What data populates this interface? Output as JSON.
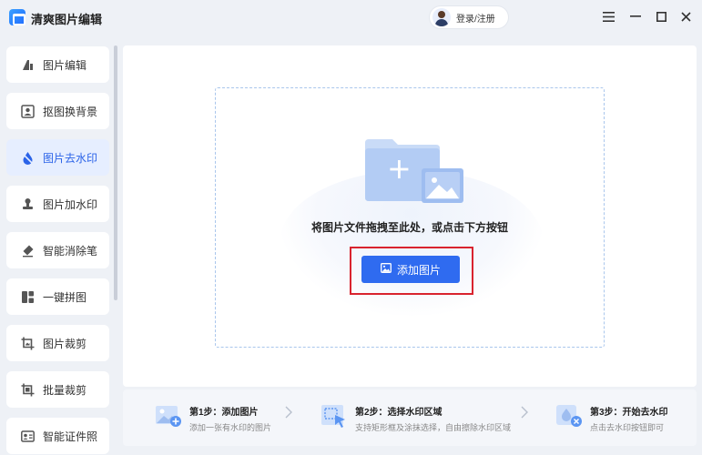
{
  "app": {
    "title": "清爽图片编辑",
    "login_label": "登录/注册",
    "window_controls": [
      "menu-icon",
      "minimize-icon",
      "maximize-icon",
      "close-icon"
    ]
  },
  "sidebar": {
    "items": [
      {
        "label": "图片编辑",
        "icon": "edit-tool-icon",
        "active": false
      },
      {
        "label": "抠图换背景",
        "icon": "portrait-frame-icon",
        "active": false
      },
      {
        "label": "图片去水印",
        "icon": "water-drop-icon",
        "active": true
      },
      {
        "label": "图片加水印",
        "icon": "stamp-icon",
        "active": false
      },
      {
        "label": "智能消除笔",
        "icon": "eraser-icon",
        "active": false
      },
      {
        "label": "一键拼图",
        "icon": "collage-icon",
        "active": false
      },
      {
        "label": "图片裁剪",
        "icon": "crop-icon",
        "active": false
      },
      {
        "label": "批量裁剪",
        "icon": "batch-crop-icon",
        "active": false
      },
      {
        "label": "智能证件照",
        "icon": "id-card-icon",
        "active": false
      }
    ]
  },
  "dropzone": {
    "hint": "将图片文件拖拽至此处，或点击下方按钮",
    "add_button_label": "添加图片"
  },
  "steps": [
    {
      "title": "第1步：添加图片",
      "desc": "添加一张有水印的图片"
    },
    {
      "title": "第2步：选择水印区域",
      "desc": "支持矩形框及涂抹选择，自由擦除水印区域"
    },
    {
      "title": "第3步：开始去水印",
      "desc": "点击去水印按钮即可"
    }
  ],
  "colors": {
    "accent": "#2f6bf0",
    "highlight_border": "#d9232e",
    "active_item_bg": "#e6eeff"
  }
}
